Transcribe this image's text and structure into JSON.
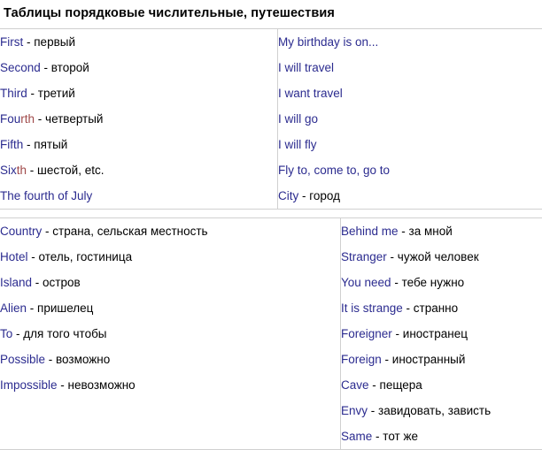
{
  "title": "Таблицы порядковые числительные, путешествия",
  "colors": {
    "term": "#2b2b8f",
    "term_highlight": "#a04a4a",
    "gloss": "#000000",
    "border": "#d0d0d0",
    "background": "#ffffff"
  },
  "tables": [
    {
      "name": "ordinal-numbers-table",
      "columns": [
        {
          "name": "ordinals-column",
          "rows": [
            {
              "term": "First",
              "term_tail": "",
              "sep": " - ",
              "gloss": "первый"
            },
            {
              "term": "Second",
              "term_tail": "",
              "sep": " - ",
              "gloss": "второй"
            },
            {
              "term": "Third",
              "term_tail": "",
              "sep": " - ",
              "gloss": "третий"
            },
            {
              "term": "Fou",
              "term_tail": "rth",
              "sep": " - ",
              "gloss": "четвертый"
            },
            {
              "term": "Fifth",
              "term_tail": "",
              "sep": " - ",
              "gloss": "пятый"
            },
            {
              "term": "Six",
              "term_tail": "th",
              "sep": " - ",
              "gloss": "шестой, etc."
            },
            {
              "term": "The fourth of July",
              "term_tail": "",
              "sep": "",
              "gloss": ""
            }
          ]
        },
        {
          "name": "travel-phrases-column",
          "rows": [
            {
              "phrase": "My birthday is on..."
            },
            {
              "phrase": "I will travel"
            },
            {
              "phrase": "I want travel"
            },
            {
              "phrase": "I will go"
            },
            {
              "phrase": "I will fly"
            },
            {
              "phrase": "Fly to, come to, go to"
            },
            {
              "phrase": "City",
              "sep": " - ",
              "gloss": "город"
            }
          ]
        }
      ]
    },
    {
      "name": "travel-vocabulary-table",
      "columns": [
        {
          "name": "places-column",
          "rows": [
            {
              "term": "Country",
              "sep": " - ",
              "gloss": "страна, сельская местность"
            },
            {
              "term": "Hotel",
              "sep": " - ",
              "gloss": "отель, гостиница"
            },
            {
              "term": "Island",
              "sep": " - ",
              "gloss": "остров"
            },
            {
              "term": "Alien",
              "sep": " - ",
              "gloss": "пришелец"
            },
            {
              "term": "To",
              "sep": " - ",
              "gloss": "для того чтобы"
            },
            {
              "term": "Possible",
              "sep": " - ",
              "gloss": "возможно"
            },
            {
              "term": "Impossible",
              "sep": " - ",
              "gloss": "невозможно"
            }
          ]
        },
        {
          "name": "strangers-column",
          "rows": [
            {
              "term": "Behind me",
              "sep": " - ",
              "gloss": "за мной"
            },
            {
              "term": "Stranger",
              "sep": " - ",
              "gloss": "чужой человек"
            },
            {
              "term": "You need",
              "sep": " - ",
              "gloss": "тебе нужно"
            },
            {
              "term": "It is strange",
              "sep": " - ",
              "gloss": "странно"
            },
            {
              "term": "Foreigner",
              "sep": " - ",
              "gloss": "иностранец"
            },
            {
              "term": "Foreign",
              "sep": " - ",
              "gloss": "иностранный"
            },
            {
              "term": "Cave",
              "sep": " - ",
              "gloss": "пещера"
            },
            {
              "term": "Envy",
              "sep": " - ",
              "gloss": "завидовать, зависть"
            },
            {
              "term": "Same",
              "sep": " - ",
              "gloss": "тот же"
            }
          ]
        }
      ]
    }
  ]
}
